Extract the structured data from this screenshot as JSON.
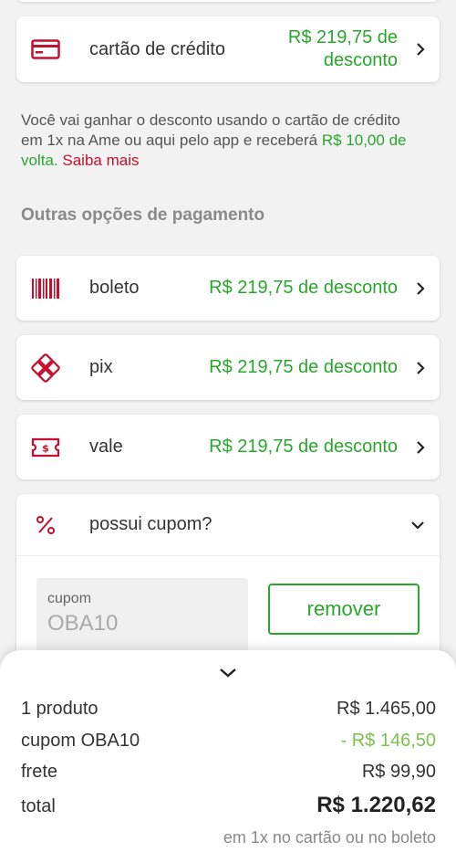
{
  "payment_options": {
    "primary": {
      "label": "cartão de crédito",
      "discount_line1": "R$ 219,75 de",
      "discount_line2": "desconto"
    },
    "info": {
      "text": "Você vai ganhar o desconto usando o cartão de crédito em 1x na Ame ou aqui pelo app e receberá ",
      "cashback": "R$ 10,00 de volta.",
      "learn_more": "Saiba mais"
    },
    "section_title": "Outras opções de pagamento",
    "others": [
      {
        "label": "boleto",
        "discount": "R$ 219,75 de desconto",
        "icon": "barcode-icon"
      },
      {
        "label": "pix",
        "discount": "R$ 219,75 de desconto",
        "icon": "pix-icon"
      },
      {
        "label": "vale",
        "discount": "R$ 219,75 de desconto",
        "icon": "voucher-icon"
      }
    ]
  },
  "coupon": {
    "header_label": "possui cupom?",
    "field_label": "cupom",
    "field_value": "OBA10",
    "remove_label": "remover"
  },
  "summary": {
    "products_label": "1 produto",
    "products_value": "R$ 1.465,00",
    "coupon_label": "cupom OBA10",
    "coupon_value": "- R$ 146,50",
    "shipping_label": "frete",
    "shipping_value": "R$ 99,90",
    "total_label": "total",
    "total_value": "R$ 1.220,62",
    "note": "em 1x no cartão ou no boleto"
  },
  "colors": {
    "accent_red": "#c4102e",
    "discount_green": "#27a82a",
    "coupon_green": "#7dc24a"
  }
}
